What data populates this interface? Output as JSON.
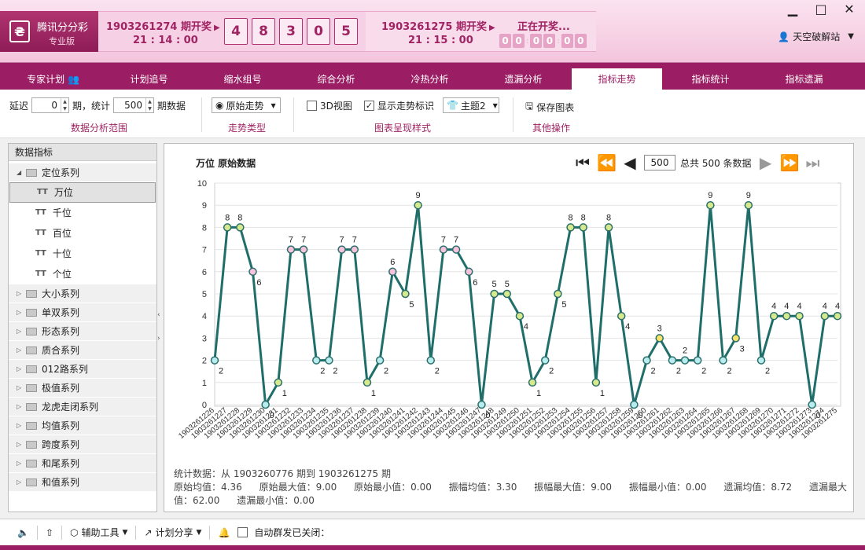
{
  "app": {
    "title": "腾讯分分彩",
    "edition": "专业版"
  },
  "last_draw": {
    "period": "1903261274 期开奖",
    "time": "21 : 14 : 00",
    "numbers": [
      "4",
      "8",
      "3",
      "0",
      "5"
    ]
  },
  "next_draw": {
    "period": "1903261275 期开奖",
    "time": "21 : 15 : 00",
    "status": "正在开奖...",
    "pending": [
      "0",
      "0",
      "0",
      "0",
      "0",
      "0"
    ]
  },
  "user": {
    "name": "天空破解站"
  },
  "nav": {
    "tabs": [
      "专家计划",
      "计划追号",
      "缩水组号",
      "综合分析",
      "冷热分析",
      "遗漏分析",
      "指标走势",
      "指标统计",
      "指标遗漏"
    ],
    "active_index": 6
  },
  "toolbar": {
    "delay_label": "延迟",
    "delay_value": "0",
    "period_label": "期，统计",
    "count_value": "500",
    "count_suffix": "期数据",
    "range_group": "数据分析范围",
    "trend_type_value": "原始走势",
    "trend_group": "走势类型",
    "view3d_label": "3D视图",
    "show_marks_label": "显示走势标识",
    "theme_value": "主题2",
    "style_group": "图表呈现样式",
    "save_label": "保存图表",
    "other_group": "其他操作"
  },
  "sidebar": {
    "header": "数据指标",
    "expanded_group": "定位系列",
    "leaves": [
      "万位",
      "千位",
      "百位",
      "十位",
      "个位"
    ],
    "selected_leaf": 0,
    "groups": [
      "大小系列",
      "单双系列",
      "形态系列",
      "质合系列",
      "012路系列",
      "极值系列",
      "龙虎走闭系列",
      "均值系列",
      "跨度系列",
      "和尾系列",
      "和值系列"
    ]
  },
  "chart_panel": {
    "title": "万位  原始数据",
    "pager_value": "500",
    "pager_total": "总共 500 条数据"
  },
  "stats": {
    "line1": "统计数据：从 1903260776 期到 1903261275 期",
    "items": [
      "原始均值：4.36",
      "原始最大值：9.00",
      "原始最小值：0.00",
      "振幅均值：3.30",
      "振幅最大值：9.00",
      "振幅最小值：0.00",
      "遗漏均值：8.72",
      "遗漏最大值：62.00",
      "遗漏最小值：0.00"
    ]
  },
  "statusbar": {
    "tools": "辅助工具",
    "share": "计划分享",
    "auto": "自动群发已关闭："
  },
  "chart_data": {
    "type": "line",
    "title": "万位  原始数据",
    "ylim": [
      0,
      10
    ],
    "yticks": [
      0,
      1,
      2,
      3,
      4,
      5,
      6,
      7,
      8,
      9,
      10
    ],
    "categories": [
      "1903261226",
      "1903261227",
      "1903261228",
      "1903261229",
      "1903261230",
      "1903261231",
      "1903261232",
      "1903261233",
      "1903261234",
      "1903261235",
      "1903261236",
      "1903261237",
      "1903261238",
      "1903261239",
      "1903261240",
      "1903261241",
      "1903261242",
      "1903261243",
      "1903261244",
      "1903261245",
      "1903261246",
      "1903261247",
      "1903261248",
      "1903261249",
      "1903261250",
      "1903261251",
      "1903261252",
      "1903261253",
      "1903261254",
      "1903261255",
      "1903261256",
      "1903261257",
      "1903261258",
      "1903261259",
      "1903261260",
      "1903261261",
      "1903261262",
      "1903261263",
      "1903261264",
      "1903261265",
      "1903261266",
      "1903261267",
      "1903261268",
      "1903261269",
      "1903261270",
      "1903261271",
      "1903261272",
      "1903261273",
      "1903261274",
      "1903261275"
    ],
    "values": [
      2,
      8,
      8,
      6,
      0,
      1,
      7,
      7,
      2,
      2,
      7,
      7,
      1,
      2,
      6,
      5,
      9,
      2,
      7,
      7,
      6,
      0,
      5,
      5,
      4,
      1,
      2,
      5,
      8,
      8,
      1,
      8,
      4,
      0,
      2,
      3,
      2,
      2,
      2,
      9,
      2,
      3,
      9,
      2,
      4,
      4,
      4,
      0,
      4,
      4
    ],
    "grid": true,
    "line_color": "#1f6e6a"
  }
}
